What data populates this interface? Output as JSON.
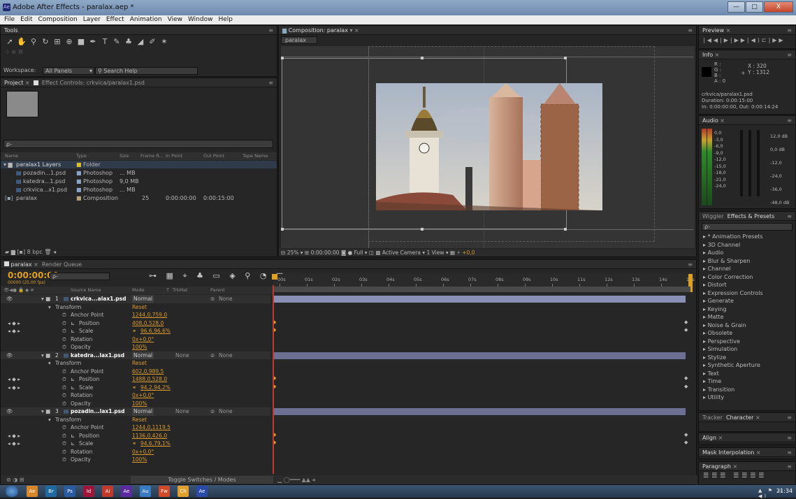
{
  "window": {
    "title": "Adobe After Effects - paralax.aep *",
    "app_icon": "Ae",
    "minimize": "—",
    "maximize": "□",
    "close": "X"
  },
  "menu": [
    "File",
    "Edit",
    "Composition",
    "Layer",
    "Effect",
    "Animation",
    "View",
    "Window",
    "Help"
  ],
  "tools": {
    "tab": "Tools",
    "workspace_label": "Workspace:",
    "workspace_value": "All Panels",
    "search_placeholder": "Search Help"
  },
  "project": {
    "tab": "Project",
    "effect_tab": "Effect Controls: crkvica/paralax1.psd",
    "search": "ρ-",
    "columns": [
      "Name",
      "Type",
      "Size",
      "Frame R...",
      "In Point",
      "Out Point",
      "Tape Name"
    ],
    "rows": [
      {
        "name": "paralax1 Layers",
        "type": "Folder",
        "size": "",
        "fr": "",
        "in": "",
        "out": ""
      },
      {
        "name": "pozadin...1.psd",
        "type": "Photoshop",
        "size": "... MB",
        "fr": "",
        "in": "",
        "out": ""
      },
      {
        "name": "katedra...1.psd",
        "type": "Photoshop",
        "size": "9,0 MB",
        "fr": "",
        "in": "",
        "out": ""
      },
      {
        "name": "crkvica...x1.psd",
        "type": "Photoshop",
        "size": "... MB",
        "fr": "",
        "in": "",
        "out": ""
      },
      {
        "name": "paralax",
        "type": "Composition",
        "size": "",
        "fr": "25",
        "in": "0:00:00:00",
        "out": "0:00:15:00"
      }
    ],
    "footer_bpc": "8 bpc"
  },
  "composition": {
    "tab": "Composition: paralax",
    "crumb": "paralax",
    "zoom": "25%",
    "timecode": "0:00:00:00",
    "resolution": "Full",
    "camera": "Active Camera",
    "view": "1 View",
    "exposure": "+0,0"
  },
  "preview": {
    "tab": "Preview",
    "buttons": [
      "|◀",
      "◀|",
      "▶",
      "|▶",
      "▶|",
      "◀)",
      "⊏",
      "|▶▶"
    ]
  },
  "info": {
    "tab": "Info",
    "r": "R :",
    "g": "G :",
    "b": "B :",
    "a": "A : 0",
    "x": "X : 320",
    "y": "Y : 1312",
    "file": "crkvica/paralax1.psd",
    "duration": "Duration: 0:00:15:00",
    "inout": "In: 0:00:00:00, Out: 0:00:14:24"
  },
  "audio": {
    "tab": "Audio",
    "left_scale": [
      "0,0",
      "-3,0",
      "-6,0",
      "-9,0",
      "-12,0",
      "-15,0",
      "-18,0",
      "-21,0",
      "-24,0"
    ],
    "right_scale": [
      "12,0 dB",
      "0,0 dB",
      "-12,0",
      "-24,0",
      "-36,0",
      "-48,0 dB"
    ]
  },
  "effects": {
    "tab_wiggler": "Wiggler",
    "tab": "Effects & Presets",
    "search": "ρ-",
    "items": [
      "* Animation Presets",
      "3D Channel",
      "Audio",
      "Blur & Sharpen",
      "Channel",
      "Color Correction",
      "Distort",
      "Expression Controls",
      "Generate",
      "Keying",
      "Matte",
      "Noise & Grain",
      "Obsolete",
      "Perspective",
      "Simulation",
      "Stylize",
      "Synthetic Aperture",
      "Text",
      "Time",
      "Transition",
      "Utility"
    ]
  },
  "tracker": {
    "tab": "Tracker",
    "tab2": "Character"
  },
  "align": {
    "tab": "Align"
  },
  "mask": {
    "tab": "Mask Interpolation"
  },
  "paragraph": {
    "tab": "Paragraph"
  },
  "timeline": {
    "tab": "paralax",
    "tab2": "Render Queue",
    "timecode": "0:00:00:00",
    "fps": "00000 (25.00 fps)",
    "search": "ρ-",
    "col_source": "Source Name",
    "col_mode": "Mode",
    "col_t": "T",
    "col_trkmat": "TrkMat",
    "col_parent": "Parent",
    "ruler": [
      "00s",
      "01s",
      "02s",
      "03s",
      "04s",
      "05s",
      "06s",
      "07s",
      "08s",
      "09s",
      "10s",
      "11s",
      "12s",
      "13s",
      "14s",
      "15s"
    ],
    "toggle": "Toggle Switches / Modes",
    "layers": [
      {
        "num": "1",
        "name": "crkvica...alax1.psd",
        "mode": "Normal",
        "trk": "",
        "parent": "None",
        "anchor": "1244,0,759,0",
        "position": "408,0,528,0",
        "scale": "96,6,96,6%",
        "rotation": "0x+0,0°",
        "opacity": "100%"
      },
      {
        "num": "2",
        "name": "katedra...lax1.psd",
        "mode": "Normal",
        "trk": "None",
        "parent": "None",
        "anchor": "602,0,989,5",
        "position": "1488,0,528,0",
        "scale": "94,2,94,2%",
        "rotation": "0x+0,0°",
        "opacity": "100%"
      },
      {
        "num": "3",
        "name": "pozadin...lax1.psd",
        "mode": "Normal",
        "trk": "None",
        "parent": "None",
        "anchor": "1244,0,1119,5",
        "position": "1136,0,426,0",
        "scale": "94,6,79,1%",
        "rotation": "0x+0,0°",
        "opacity": "100%"
      }
    ],
    "transform": "Transform",
    "reset": "Reset",
    "anchor_lbl": "Anchor Point",
    "position_lbl": "Position",
    "scale_lbl": "Scale",
    "rotation_lbl": "Rotation",
    "opacity_lbl": "Opacity"
  },
  "taskbar": {
    "clock": "21:34",
    "apps": [
      "Ae",
      "Br",
      "Ps",
      "Id",
      "Ai",
      "Ae",
      "Au",
      "Fw",
      "Ch",
      "Ae"
    ]
  }
}
